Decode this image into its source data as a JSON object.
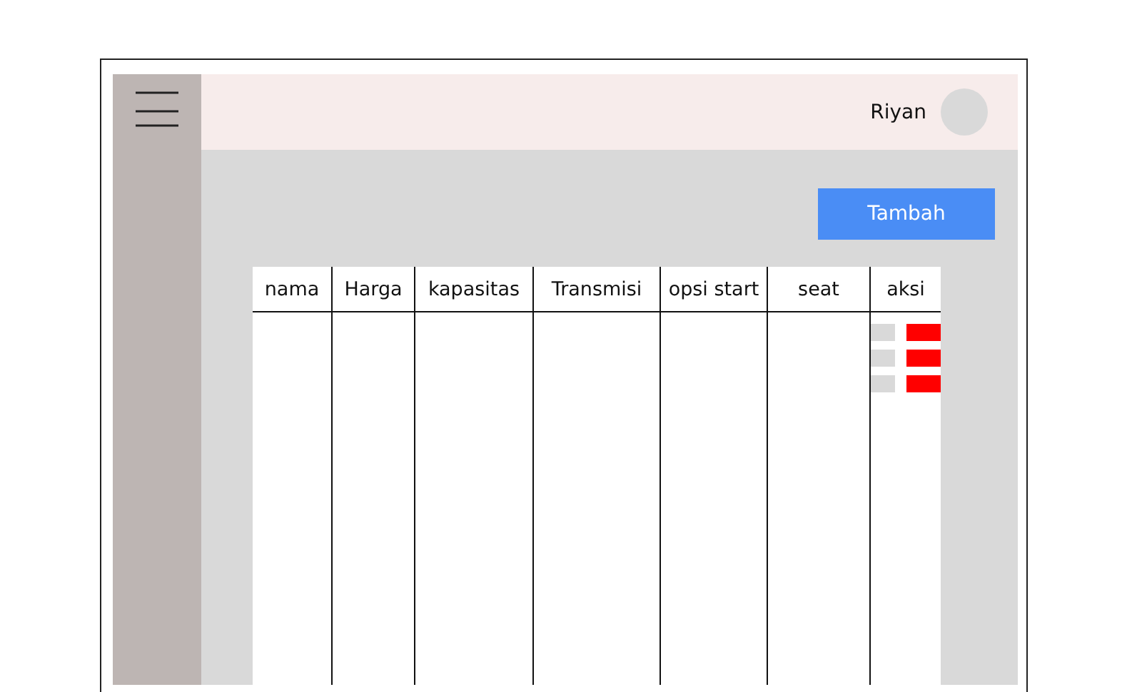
{
  "header": {
    "user_name": "Riyan"
  },
  "add_button": {
    "label": "Tambah"
  },
  "table": {
    "columns": [
      "nama",
      "Harga",
      "kapasitas",
      "Transmisi",
      "opsi start",
      "seat",
      "aksi"
    ],
    "rows": [
      {
        "actions": [
          {
            "color": "#d9d9d9"
          },
          {
            "color": "#ff0000"
          }
        ]
      },
      {
        "actions": [
          {
            "color": "#d9d9d9"
          },
          {
            "color": "#ff0000"
          }
        ]
      },
      {
        "actions": [
          {
            "color": "#d9d9d9"
          },
          {
            "color": "#ff0000"
          }
        ]
      }
    ]
  }
}
